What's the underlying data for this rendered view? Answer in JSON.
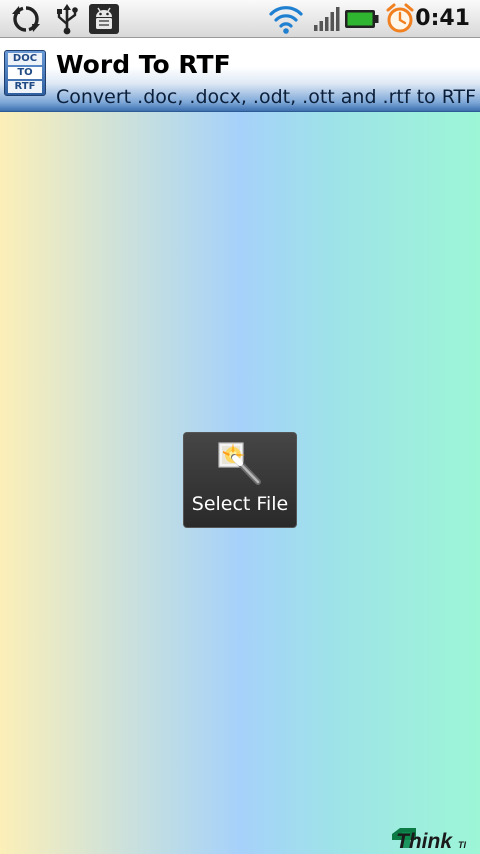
{
  "status_bar": {
    "time": "0:41",
    "icons": [
      "sync-icon",
      "usb-icon",
      "android-debug-icon",
      "wifi-icon",
      "signal-icon",
      "battery-icon",
      "alarm-clock-icon"
    ]
  },
  "title_bar": {
    "app_icon_lines": [
      "DOC",
      "TO",
      "RTF"
    ],
    "title": "Word To RTF",
    "subtitle": "Convert .doc, .docx, .odt, .ott and .rtf to RTF"
  },
  "main": {
    "select_file_label": "Select File",
    "select_file_icon": "magic-wand-icon"
  },
  "branding": {
    "logo_text": "Think",
    "logo_suffix": "TI"
  },
  "colors": {
    "battery_green": "#2fb52f",
    "alarm_orange": "#f08020",
    "title_bar_blue": "#3d6fb0",
    "button_dark": "#333333"
  }
}
